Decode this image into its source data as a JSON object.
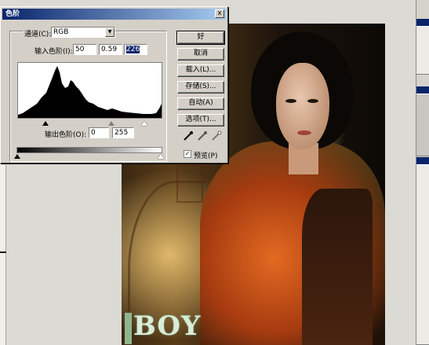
{
  "dialog": {
    "title": "色阶",
    "close_symbol": "x",
    "channel_label": "通道(C):",
    "channel_value": "RGB",
    "input_levels_label": "输入色阶(I):",
    "input_black": "50",
    "input_gamma": "0.59",
    "input_white": "226",
    "output_levels_label": "输出色阶(O):",
    "output_black": "0",
    "output_white": "255",
    "buttons": {
      "ok": "好",
      "cancel": "取消",
      "load": "载入(L)...",
      "save": "存储(S)...",
      "auto": "自动(A)",
      "options": "选项(T)..."
    },
    "preview_label": "预览(P)",
    "preview_checked": "✓"
  },
  "poster": {
    "title_text": "BOY"
  },
  "colors": {
    "titlebar": "#0a246a",
    "dialog_bg": "#d4d0c8"
  }
}
